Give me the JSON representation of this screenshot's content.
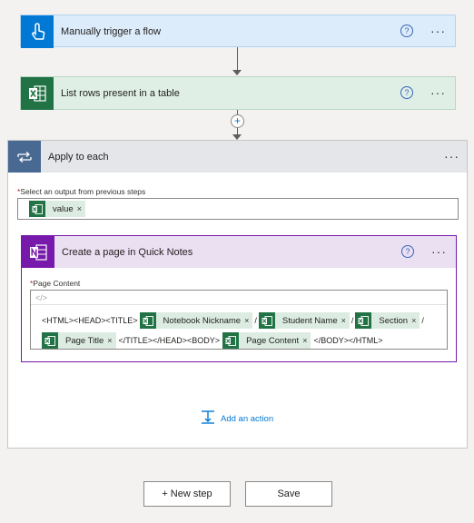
{
  "trigger": {
    "title": "Manually trigger a flow",
    "color": "#0078d4",
    "icon": "touch-icon"
  },
  "list_rows": {
    "title": "List rows present in a table",
    "color": "#217346",
    "icon": "excel-icon"
  },
  "apply_each": {
    "title": "Apply to each",
    "color": "#486991",
    "field_label": "Select an output from previous steps",
    "required_mark": "*",
    "token": "value",
    "add_action": "Add an action"
  },
  "onenote": {
    "title": "Create a page in Quick Notes",
    "color": "#7719aa",
    "field_label": "Page Content",
    "required_mark": "*",
    "code_glyph": "</>",
    "line1": {
      "t0": "<HTML><HEAD><TITLE>",
      "tok1": "Notebook Nickname",
      "s1": "/",
      "tok2": "Student Name",
      "s2": "/",
      "tok3": "Section",
      "s3": "/"
    },
    "line2": {
      "tok4": "Page Title",
      "t1": "</TITLE></HEAD><BODY>",
      "tok5": "Page Content",
      "t2": "</BODY></HTML>"
    }
  },
  "help_glyph": "?",
  "more_glyph": "···",
  "remove_glyph": "×",
  "new_step_label": "+ New step",
  "save_label": "Save",
  "insert_glyph": "+"
}
